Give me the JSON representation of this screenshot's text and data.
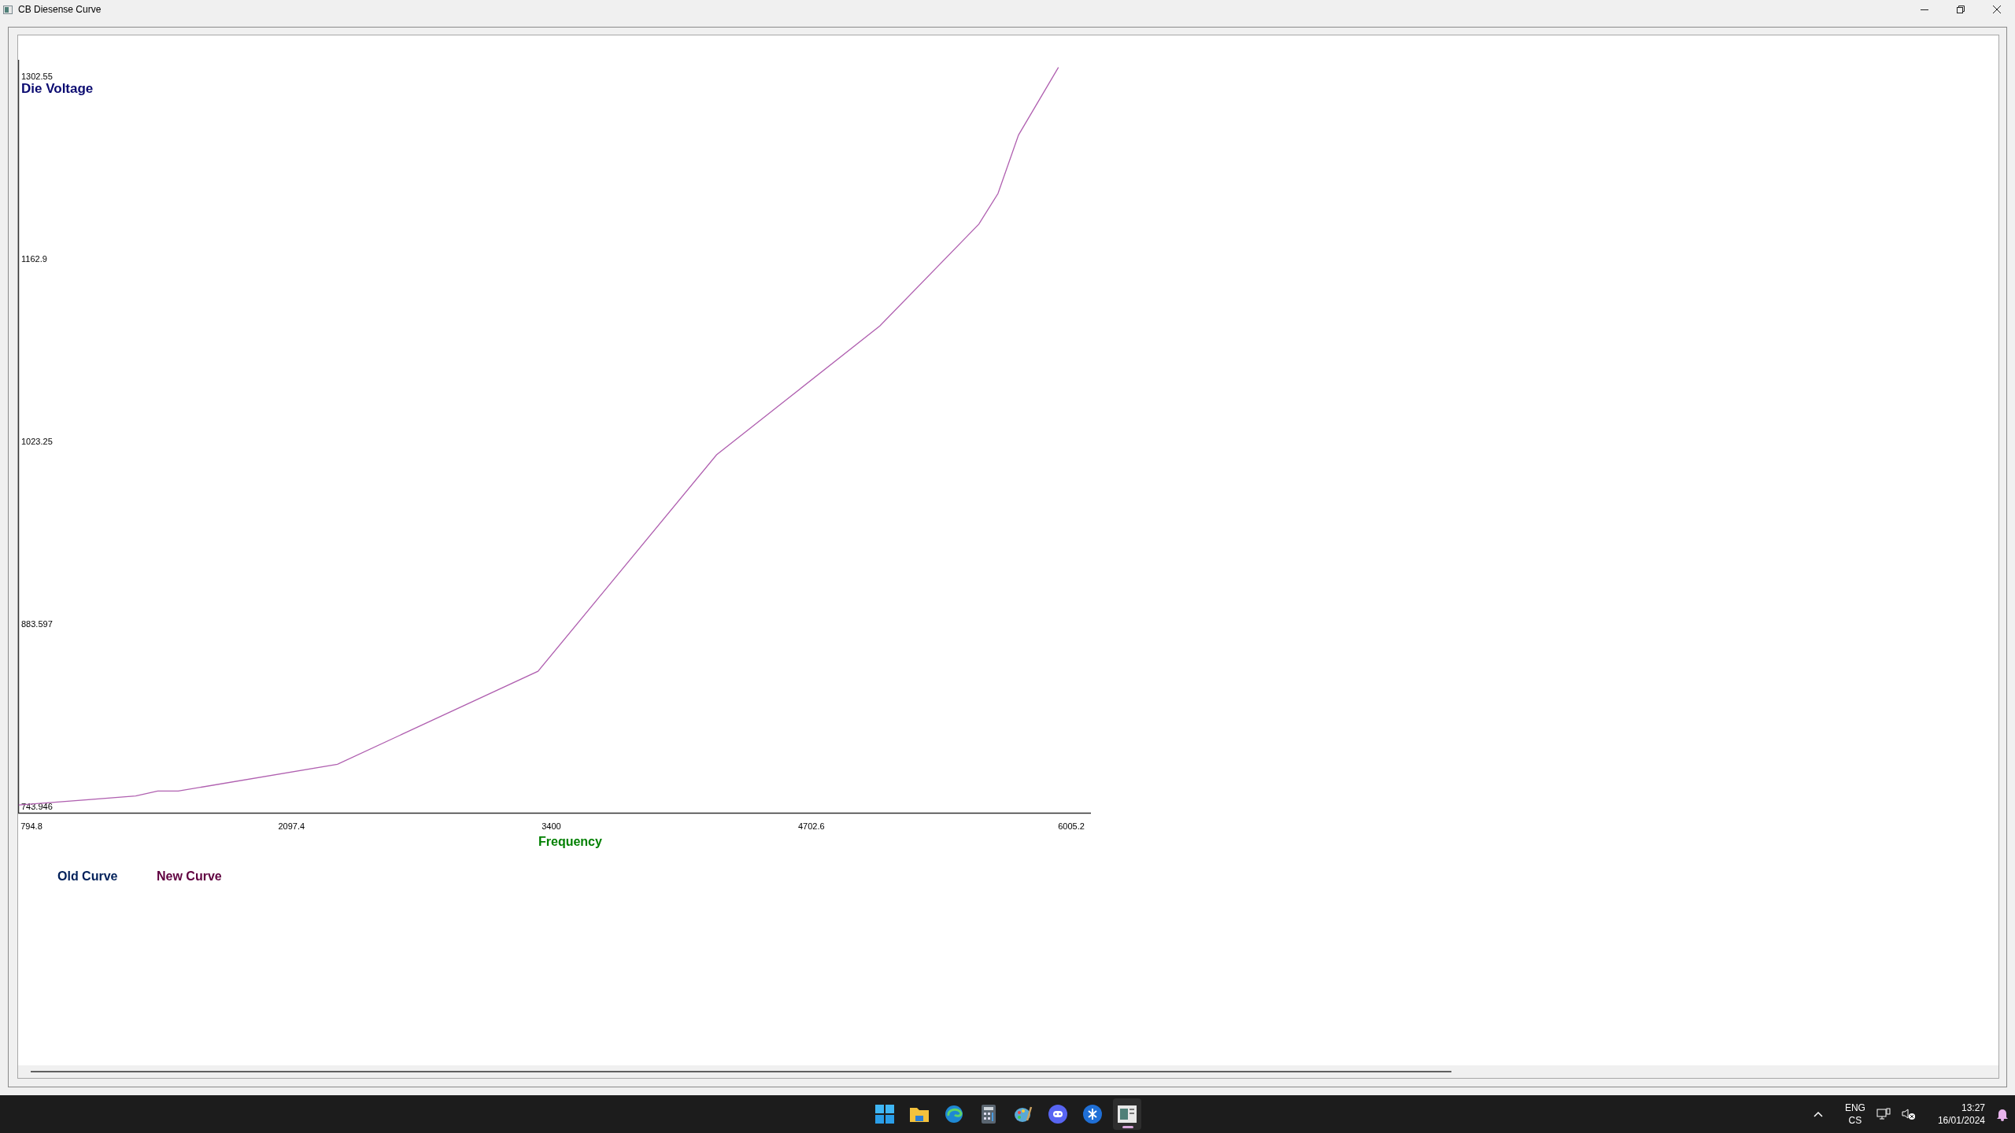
{
  "window": {
    "title": "CB Diesense Curve"
  },
  "chart": {
    "chart_data": {
      "type": "line",
      "xlabel": "Frequency",
      "ylabel": "Die Voltage",
      "x": [
        731,
        1317,
        1427,
        1530,
        2328,
        3333,
        4228,
        5046,
        5542,
        5638,
        5741,
        5941
      ],
      "series": [
        {
          "color": "#b060b0",
          "values": [
            745.1,
            752,
            755.8,
            755.8,
            776.3,
            847.4,
            1013,
            1111.5,
            1189.4,
            1212.8,
            1257.6,
            1309.3
          ]
        }
      ],
      "xlim": [
        727.7,
        6103.8
      ],
      "ylim": [
        739.2,
        1315.1
      ],
      "xticks": [
        794.8,
        2097.4,
        3400,
        4702.6,
        6005.2
      ],
      "yticks": [
        743.946,
        883.597,
        1023.25,
        1162.9,
        1302.55
      ]
    }
  },
  "legend": [
    {
      "label": "Old Curve",
      "color": "#00205a"
    },
    {
      "label": "New Curve",
      "color": "#600040"
    }
  ],
  "taskbar": {
    "language": "ENG",
    "layout": "CS",
    "time": "13:27",
    "date": "16/01/2024"
  }
}
